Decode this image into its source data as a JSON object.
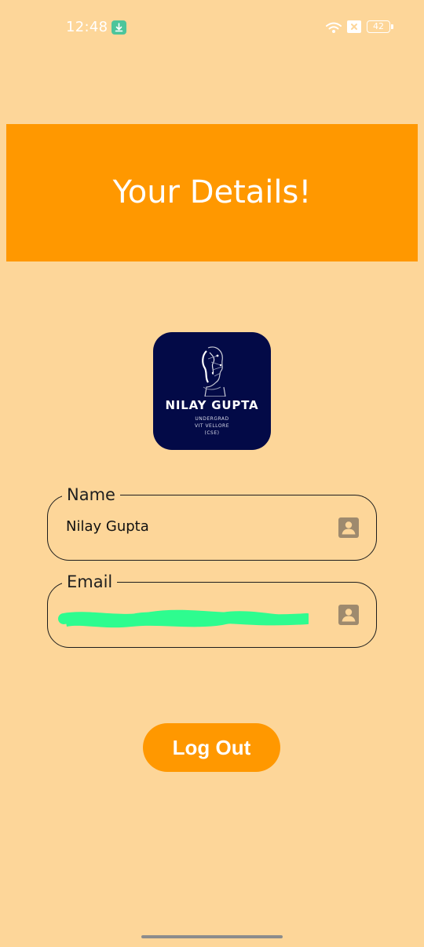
{
  "status_bar": {
    "time": "12:48",
    "battery_level": "42",
    "icons": [
      "download-icon",
      "wifi-icon",
      "sim-icon",
      "battery-icon"
    ]
  },
  "header": {
    "title": "Your Details!"
  },
  "profile": {
    "name": "NILAY GUPTA",
    "subtitle_lines": [
      "UNDERGRAD",
      "VIT VELLORE",
      "(CSE)"
    ]
  },
  "form": {
    "name_field": {
      "label": "Name",
      "value": "Nilay Gupta",
      "icon": "contact-icon"
    },
    "email_field": {
      "label": "Email",
      "value": "",
      "icon": "contact-icon"
    }
  },
  "actions": {
    "logout_label": "Log Out"
  },
  "colors": {
    "background": "#FDD699",
    "accent": "#FF9800",
    "profile_bg": "#030a47",
    "redaction": "#2EFC8F",
    "icon": "#9E8A6E"
  }
}
